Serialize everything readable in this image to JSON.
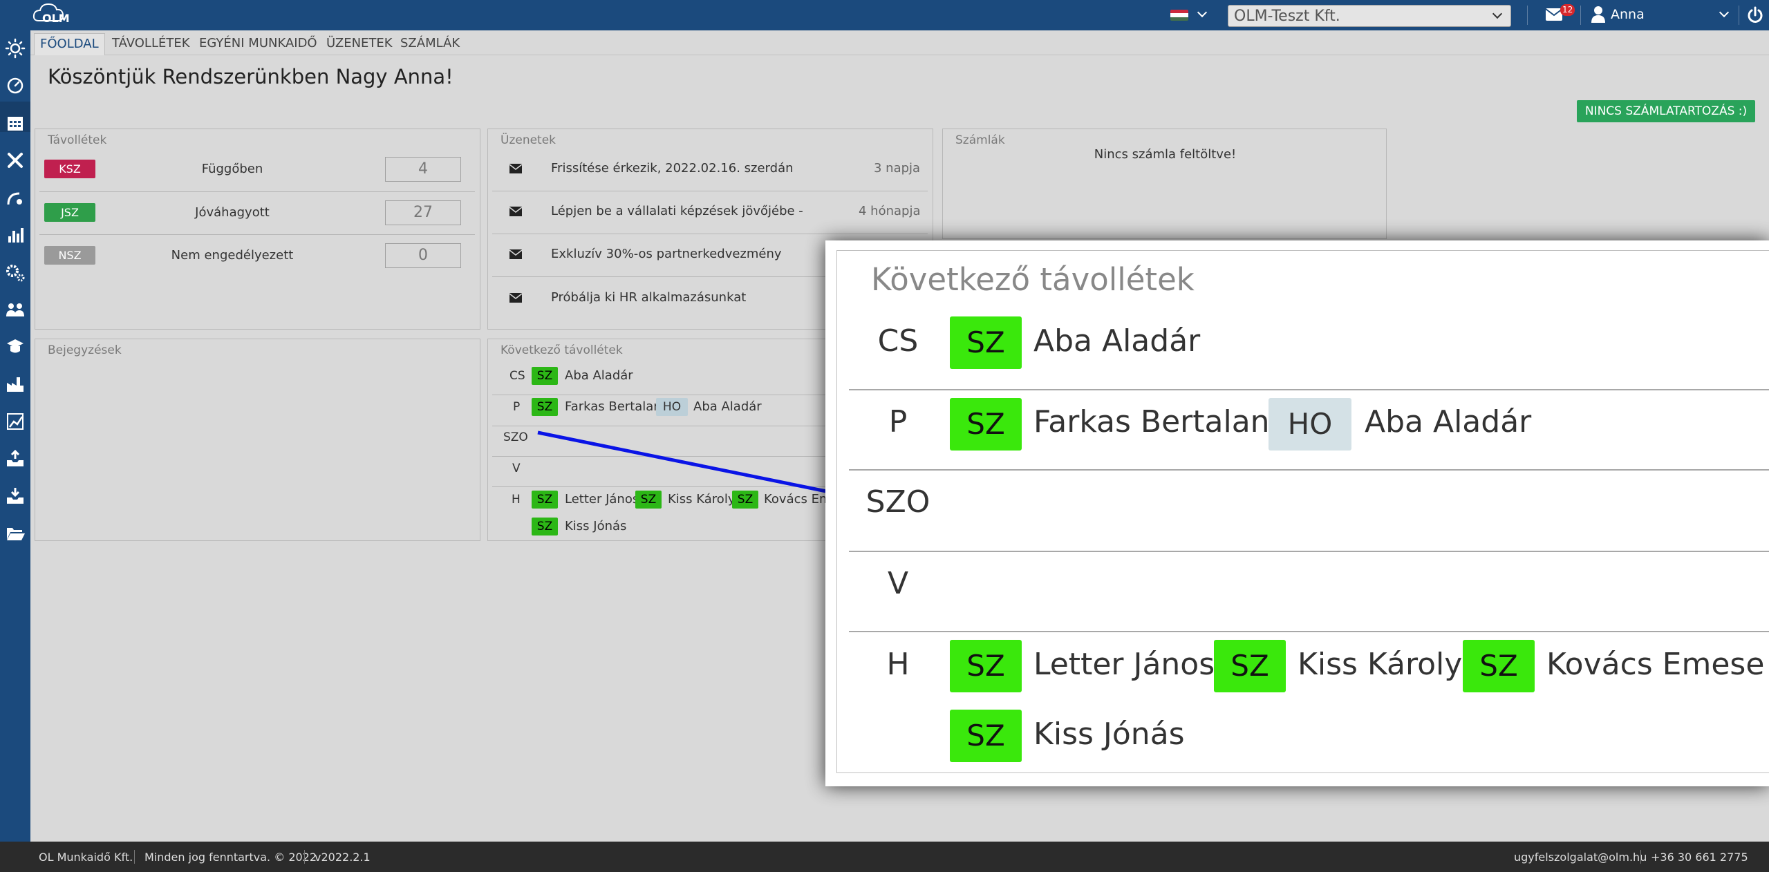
{
  "topbar": {
    "logo_text": "OLM",
    "company": "OLM-Teszt Kft.",
    "mail_count": "12",
    "user_name": "Anna"
  },
  "tabs": [
    "FŐOLDAL",
    "TÁVOLLÉTEK",
    "EGYÉNI MUNKAIDŐ",
    "ÜZENETEK",
    "SZÁMLÁK"
  ],
  "welcome": "Köszöntjük Rendszerünkben Nagy Anna!",
  "debt_button": "NINCS SZÁMLATARTOZÁS :)",
  "absences": {
    "title": "Távollétek",
    "rows": [
      {
        "code": "KSZ",
        "status": "Függőben",
        "count": "4",
        "color": "#c0204f"
      },
      {
        "code": "JSZ",
        "status": "Jóváhagyott",
        "count": "27",
        "color": "#2f9e4a"
      },
      {
        "code": "NSZ",
        "status": "Nem engedélyezett",
        "count": "0",
        "color": "#9a9a9a"
      }
    ]
  },
  "messages": {
    "title": "Üzenetek",
    "items": [
      {
        "text": "Frissítése érkezik, 2022.02.16. szerdán",
        "time": "3 napja"
      },
      {
        "text": "Lépjen be a vállalati képzések jövőjébe -",
        "time": "4 hónapja"
      },
      {
        "text": "Exkluzív 30%-os partnerkedvezmény",
        "time": ""
      },
      {
        "text": "Próbálja ki HR alkalmazásunkat",
        "time": ""
      }
    ]
  },
  "invoices": {
    "title": "Számlák",
    "empty_text": "Nincs számla feltöltve!"
  },
  "entries": {
    "title": "Bejegyzések"
  },
  "next_absences": {
    "title": "Következő távollétek",
    "days": [
      {
        "day": "CS",
        "entries": [
          {
            "type": "SZ",
            "name": "Aba Aladár"
          }
        ]
      },
      {
        "day": "P",
        "entries": [
          {
            "type": "SZ",
            "name": "Farkas Bertalan"
          },
          {
            "type": "HO",
            "name": "Aba Aladár"
          }
        ]
      },
      {
        "day": "SZO",
        "entries": []
      },
      {
        "day": "V",
        "entries": []
      },
      {
        "day": "H",
        "entries": [
          {
            "type": "SZ",
            "name": "Letter János"
          },
          {
            "type": "SZ",
            "name": "Kiss Károly"
          },
          {
            "type": "SZ",
            "name": "Kovács Emese"
          },
          {
            "type": "SZ",
            "name": "Kiss Jónás"
          }
        ]
      }
    ],
    "small_truncated_name": "Kovács Em"
  },
  "footer": {
    "company": "OL Munkaidő Kft.",
    "rights": "Minden jog fenntartva. © 2022",
    "version": "v2022.2.1",
    "email": "ugyfelszolgalat@olm.hu",
    "phone": "+36 30 661 2775"
  },
  "colors": {
    "primary": "#1b4a7d",
    "success": "#29a35a",
    "zoom_green": "#3ae80c",
    "annotation_line": "#0a14e6"
  },
  "icons": {
    "sidebar": [
      "sun-icon",
      "dashboard-icon",
      "calendar-icon",
      "tools-icon",
      "satellite-icon",
      "bar-chart-icon",
      "gears-icon",
      "users-icon",
      "graduate-icon",
      "factory-icon",
      "grid-chart-icon",
      "inbox-upload-icon",
      "inbox-download-icon",
      "folder-open-icon"
    ]
  }
}
